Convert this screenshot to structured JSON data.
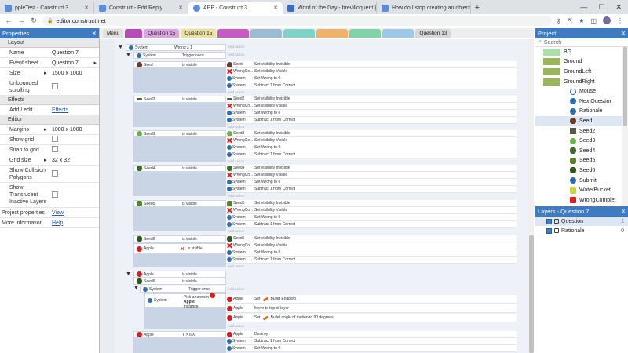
{
  "browser": {
    "tabs": [
      {
        "title": "ppleTest - Construct 3",
        "color": "#5b8dd9"
      },
      {
        "title": "Construct - Edit Reply",
        "color": "#5b8dd9"
      },
      {
        "title": "APP - Construct 3",
        "color": "#5b8dd9",
        "active": true
      },
      {
        "title": "Word of the Day - brevilloquent |",
        "color": "#3a6fc4"
      },
      {
        "title": "How do I stop creating an object",
        "color": "#5b8dd9"
      }
    ],
    "new_tab": "+",
    "minimize": "—",
    "maximize": "☐",
    "close": "✕",
    "url": "editor.construct.net",
    "lock_icon": "🔒"
  },
  "properties": {
    "header": "Properties",
    "sections": {
      "layout": "Layout",
      "effects": "Effects",
      "editor": "Editor"
    },
    "name_label": "Name",
    "name_value": "Question 7",
    "event_sheet_label": "Event sheet",
    "event_sheet_value": "Question 7",
    "size_label": "Size",
    "size_value": "1500 x 1000",
    "unbounded_label": "Unbounded scrolling",
    "add_edit_label": "Add / edit",
    "effects_link": "Effects",
    "margins_label": "Margins",
    "margins_value": "1000 x 1000",
    "show_grid_label": "Show grid",
    "snap_label": "Snap to grid",
    "grid_size_label": "Grid size",
    "grid_size_value": "32 x 32",
    "show_collision_label": "Show Collision Polygons",
    "show_translucent_label": "Show Translucent Inactive Layers",
    "project_props_label": "Project properties",
    "project_props_link": "View",
    "more_info_label": "More information",
    "more_info_link": "Help"
  },
  "event_tabs": [
    {
      "label": "Menu",
      "color": "#e0e0e0"
    },
    {
      "label": "",
      "color": "#b84bb8"
    },
    {
      "label": "Question 15",
      "color": "#d9a4e0"
    },
    {
      "label": "Question 15",
      "color": "#e8e1a0"
    },
    {
      "label": "",
      "color": "#c06"
    },
    {
      "label": "",
      "color": "#bbb"
    },
    {
      "label": "Question 13",
      "color": "#9ec8e8"
    }
  ],
  "events": {
    "row1": {
      "obj": "System",
      "cond": "Wrong ≥ 1"
    },
    "row2": {
      "obj": "System",
      "cond": "Trigger once"
    },
    "add_action": "Add action",
    "groups": [
      {
        "obj": "Seed",
        "cond": "is visible",
        "icon": "ic-seed",
        "actions": [
          {
            "obj": "Seed",
            "icon": "ic-seed",
            "text": "Set visibility Invisible"
          },
          {
            "obj": "WrongCo...",
            "icon": "ic-wrong",
            "text": "Set visibility Visible"
          },
          {
            "obj": "System",
            "icon": "ic-sys",
            "text": "Set Wrong to 0"
          },
          {
            "obj": "System",
            "icon": "ic-sys",
            "text": "Subtract 1 from Correct"
          }
        ]
      },
      {
        "obj": "Seed2",
        "cond": "is visible",
        "icon": "ic-seed2",
        "actions": [
          {
            "obj": "Seed2",
            "icon": "ic-seed2",
            "text": "Set visibility Invisible"
          },
          {
            "obj": "WrongCo...",
            "icon": "ic-wrong",
            "text": "Set visibility Visible"
          },
          {
            "obj": "System",
            "icon": "ic-sys",
            "text": "Set Wrong to 0"
          },
          {
            "obj": "System",
            "icon": "ic-sys",
            "text": "Subtract 1 from Correct"
          }
        ]
      },
      {
        "obj": "Seed3",
        "cond": "is visible",
        "icon": "ic-seed3",
        "actions": [
          {
            "obj": "Seed3",
            "icon": "ic-seed3",
            "text": "Set visibility Invisible"
          },
          {
            "obj": "WrongCo...",
            "icon": "ic-wrong",
            "text": "Set visibility Visible"
          },
          {
            "obj": "System",
            "icon": "ic-sys",
            "text": "Set Wrong to 0"
          },
          {
            "obj": "System",
            "icon": "ic-sys",
            "text": "Subtract 1 from Correct"
          }
        ]
      },
      {
        "obj": "Seed4",
        "cond": "is visible",
        "icon": "ic-seed4",
        "actions": [
          {
            "obj": "Seed4",
            "icon": "ic-seed4",
            "text": "Set visibility Invisible"
          },
          {
            "obj": "WrongCo...",
            "icon": "ic-wrong",
            "text": "Set visibility Visible"
          },
          {
            "obj": "System",
            "icon": "ic-sys",
            "text": "Set Wrong to 0"
          },
          {
            "obj": "System",
            "icon": "ic-sys",
            "text": "Subtract 1 from Correct"
          }
        ]
      },
      {
        "obj": "Seed5",
        "cond": "is visible",
        "icon": "ic-seed5",
        "actions": [
          {
            "obj": "Seed5",
            "icon": "ic-seed5",
            "text": "Set visibility Invisible"
          },
          {
            "obj": "WrongCo...",
            "icon": "ic-wrong",
            "text": "Set visibility Visible"
          },
          {
            "obj": "System",
            "icon": "ic-sys",
            "text": "Set Wrong to 0"
          },
          {
            "obj": "System",
            "icon": "ic-sys",
            "text": "Subtract 1 from Correct"
          }
        ]
      }
    ],
    "seed6": {
      "obj": "Seed6",
      "cond": "is visible",
      "apple_obj": "Apple",
      "apple_cond": "is visible",
      "actions": [
        {
          "obj": "Seed6",
          "icon": "ic-seed6",
          "text": "Set visibility Invisible"
        },
        {
          "obj": "WrongCo...",
          "icon": "ic-wrong",
          "text": "Set visibility Visible"
        },
        {
          "obj": "System",
          "icon": "ic-sys",
          "text": "Set Wrong to 0"
        },
        {
          "obj": "System",
          "icon": "ic-sys",
          "text": "Subtract 1 from Correct"
        }
      ]
    },
    "apple_group": {
      "c1_obj": "Apple",
      "c1": "is visible",
      "c2_obj": "Seed6",
      "c2": "is visible",
      "sys_obj": "System",
      "sys_cond": "Trigger once",
      "pick_obj": "System",
      "pick_text": "Pick a random",
      "pick_target": "Apple",
      "pick_suffix": "instance",
      "actions": [
        {
          "obj": "Apple",
          "text": "Set",
          "extra": "Bullet Enabled"
        },
        {
          "obj": "Apple",
          "text": "Move to top of layer",
          "extra": ""
        },
        {
          "obj": "Apple",
          "text": "Set",
          "extra": "Bullet angle of motion to 90 degrees"
        }
      ]
    },
    "last": {
      "obj": "Apple",
      "cond": "Y > 600",
      "actions": [
        {
          "obj": "Apple",
          "icon": "ic-apple",
          "text": "Destroy"
        },
        {
          "obj": "System",
          "icon": "ic-sys",
          "text": "Subtract 1 from Correct"
        },
        {
          "obj": "System",
          "icon": "ic-sys",
          "text": "Set Wrong to 0"
        }
      ]
    }
  },
  "project": {
    "header": "Project",
    "search_placeholder": "Search",
    "items": [
      {
        "name": "BG",
        "swatch": "#a8e0a8"
      },
      {
        "name": "Ground",
        "swatch": "#9ab55a"
      },
      {
        "name": "GroundLeft",
        "swatch": "#9ab55a"
      },
      {
        "name": "GroundRight",
        "swatch": "#9ab55a"
      },
      {
        "name": "Mouse",
        "swatch": ""
      },
      {
        "name": "NextQuestion",
        "swatch": ""
      },
      {
        "name": "Rationale",
        "swatch": ""
      },
      {
        "name": "Seed",
        "swatch": ""
      },
      {
        "name": "Seed2",
        "swatch": ""
      },
      {
        "name": "Seed3",
        "swatch": ""
      },
      {
        "name": "Seed4",
        "swatch": ""
      },
      {
        "name": "Seed5",
        "swatch": ""
      },
      {
        "name": "Seed6",
        "swatch": ""
      },
      {
        "name": "Submit",
        "swatch": ""
      },
      {
        "name": "WaterBucket",
        "swatch": ""
      },
      {
        "name": "WrongComplet",
        "swatch": ""
      }
    ]
  },
  "layers": {
    "header": "Layers - Question 7",
    "rows": [
      {
        "name": "Question",
        "num": "1"
      },
      {
        "name": "Rationale",
        "num": "0"
      }
    ]
  }
}
